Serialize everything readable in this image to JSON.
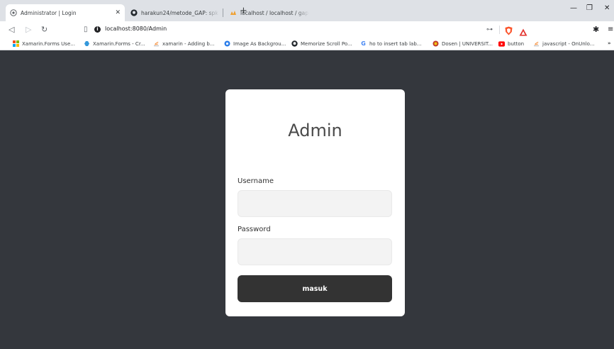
{
  "tabs": [
    {
      "title": "Administrator | Login",
      "icon": "globe-icon",
      "active": true
    },
    {
      "title": "harakun24/metode_GAP: spk mengg...",
      "icon": "github-icon",
      "active": false
    },
    {
      "title": "localhost / localhost / gap | phpMyAd...",
      "icon": "phpmyadmin-icon",
      "active": false
    }
  ],
  "toolbar": {
    "url": "localhost:8080/Admin"
  },
  "bookmarks": [
    {
      "label": "Xamarin.Forms Use...",
      "icon": "microsoft-icon"
    },
    {
      "label": "Xamarin.Forms - Cr...",
      "icon": "xamarin-icon"
    },
    {
      "label": "xamarin - Adding b...",
      "icon": "stackoverflow-icon"
    },
    {
      "label": "Image As Backgrou...",
      "icon": "blue-circle-icon"
    },
    {
      "label": "Memorize Scroll Po...",
      "icon": "github-icon"
    },
    {
      "label": "ho to insert tab lab...",
      "icon": "google-icon"
    },
    {
      "label": "Dosen | UNIVERSIT...",
      "icon": "university-icon"
    },
    {
      "label": "button",
      "icon": "youtube-icon"
    },
    {
      "label": "javascript - OnUnlo...",
      "icon": "stackoverflow-icon"
    }
  ],
  "login": {
    "title": "Admin",
    "username_label": "Username",
    "username_value": "",
    "password_label": "Password",
    "password_value": "",
    "submit_label": "masuk"
  },
  "colors": {
    "page_background": "#34373d",
    "card_background": "#ffffff",
    "input_background": "#f3f3f3",
    "button_background": "#333333",
    "button_text": "#ffffff"
  }
}
